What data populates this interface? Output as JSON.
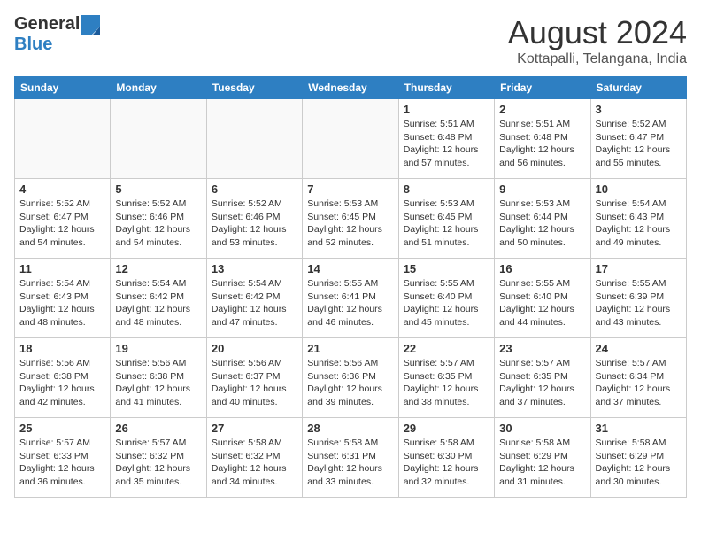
{
  "header": {
    "logo_general": "General",
    "logo_blue": "Blue",
    "main_title": "August 2024",
    "sub_title": "Kottapalli, Telangana, India"
  },
  "calendar": {
    "days_of_week": [
      "Sunday",
      "Monday",
      "Tuesday",
      "Wednesday",
      "Thursday",
      "Friday",
      "Saturday"
    ],
    "weeks": [
      [
        {
          "day": "",
          "info": ""
        },
        {
          "day": "",
          "info": ""
        },
        {
          "day": "",
          "info": ""
        },
        {
          "day": "",
          "info": ""
        },
        {
          "day": "1",
          "info": "Sunrise: 5:51 AM\nSunset: 6:48 PM\nDaylight: 12 hours\nand 57 minutes."
        },
        {
          "day": "2",
          "info": "Sunrise: 5:51 AM\nSunset: 6:48 PM\nDaylight: 12 hours\nand 56 minutes."
        },
        {
          "day": "3",
          "info": "Sunrise: 5:52 AM\nSunset: 6:47 PM\nDaylight: 12 hours\nand 55 minutes."
        }
      ],
      [
        {
          "day": "4",
          "info": "Sunrise: 5:52 AM\nSunset: 6:47 PM\nDaylight: 12 hours\nand 54 minutes."
        },
        {
          "day": "5",
          "info": "Sunrise: 5:52 AM\nSunset: 6:46 PM\nDaylight: 12 hours\nand 54 minutes."
        },
        {
          "day": "6",
          "info": "Sunrise: 5:52 AM\nSunset: 6:46 PM\nDaylight: 12 hours\nand 53 minutes."
        },
        {
          "day": "7",
          "info": "Sunrise: 5:53 AM\nSunset: 6:45 PM\nDaylight: 12 hours\nand 52 minutes."
        },
        {
          "day": "8",
          "info": "Sunrise: 5:53 AM\nSunset: 6:45 PM\nDaylight: 12 hours\nand 51 minutes."
        },
        {
          "day": "9",
          "info": "Sunrise: 5:53 AM\nSunset: 6:44 PM\nDaylight: 12 hours\nand 50 minutes."
        },
        {
          "day": "10",
          "info": "Sunrise: 5:54 AM\nSunset: 6:43 PM\nDaylight: 12 hours\nand 49 minutes."
        }
      ],
      [
        {
          "day": "11",
          "info": "Sunrise: 5:54 AM\nSunset: 6:43 PM\nDaylight: 12 hours\nand 48 minutes."
        },
        {
          "day": "12",
          "info": "Sunrise: 5:54 AM\nSunset: 6:42 PM\nDaylight: 12 hours\nand 48 minutes."
        },
        {
          "day": "13",
          "info": "Sunrise: 5:54 AM\nSunset: 6:42 PM\nDaylight: 12 hours\nand 47 minutes."
        },
        {
          "day": "14",
          "info": "Sunrise: 5:55 AM\nSunset: 6:41 PM\nDaylight: 12 hours\nand 46 minutes."
        },
        {
          "day": "15",
          "info": "Sunrise: 5:55 AM\nSunset: 6:40 PM\nDaylight: 12 hours\nand 45 minutes."
        },
        {
          "day": "16",
          "info": "Sunrise: 5:55 AM\nSunset: 6:40 PM\nDaylight: 12 hours\nand 44 minutes."
        },
        {
          "day": "17",
          "info": "Sunrise: 5:55 AM\nSunset: 6:39 PM\nDaylight: 12 hours\nand 43 minutes."
        }
      ],
      [
        {
          "day": "18",
          "info": "Sunrise: 5:56 AM\nSunset: 6:38 PM\nDaylight: 12 hours\nand 42 minutes."
        },
        {
          "day": "19",
          "info": "Sunrise: 5:56 AM\nSunset: 6:38 PM\nDaylight: 12 hours\nand 41 minutes."
        },
        {
          "day": "20",
          "info": "Sunrise: 5:56 AM\nSunset: 6:37 PM\nDaylight: 12 hours\nand 40 minutes."
        },
        {
          "day": "21",
          "info": "Sunrise: 5:56 AM\nSunset: 6:36 PM\nDaylight: 12 hours\nand 39 minutes."
        },
        {
          "day": "22",
          "info": "Sunrise: 5:57 AM\nSunset: 6:35 PM\nDaylight: 12 hours\nand 38 minutes."
        },
        {
          "day": "23",
          "info": "Sunrise: 5:57 AM\nSunset: 6:35 PM\nDaylight: 12 hours\nand 37 minutes."
        },
        {
          "day": "24",
          "info": "Sunrise: 5:57 AM\nSunset: 6:34 PM\nDaylight: 12 hours\nand 37 minutes."
        }
      ],
      [
        {
          "day": "25",
          "info": "Sunrise: 5:57 AM\nSunset: 6:33 PM\nDaylight: 12 hours\nand 36 minutes."
        },
        {
          "day": "26",
          "info": "Sunrise: 5:57 AM\nSunset: 6:32 PM\nDaylight: 12 hours\nand 35 minutes."
        },
        {
          "day": "27",
          "info": "Sunrise: 5:58 AM\nSunset: 6:32 PM\nDaylight: 12 hours\nand 34 minutes."
        },
        {
          "day": "28",
          "info": "Sunrise: 5:58 AM\nSunset: 6:31 PM\nDaylight: 12 hours\nand 33 minutes."
        },
        {
          "day": "29",
          "info": "Sunrise: 5:58 AM\nSunset: 6:30 PM\nDaylight: 12 hours\nand 32 minutes."
        },
        {
          "day": "30",
          "info": "Sunrise: 5:58 AM\nSunset: 6:29 PM\nDaylight: 12 hours\nand 31 minutes."
        },
        {
          "day": "31",
          "info": "Sunrise: 5:58 AM\nSunset: 6:29 PM\nDaylight: 12 hours\nand 30 minutes."
        }
      ]
    ]
  }
}
